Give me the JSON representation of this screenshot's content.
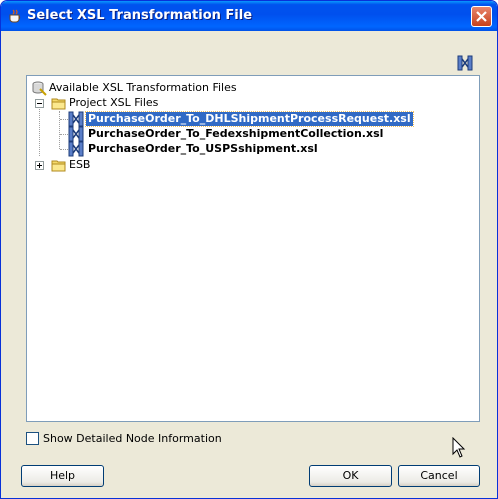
{
  "window": {
    "title": "Select XSL Transformation File"
  },
  "tree": {
    "root_label": "Available XSL Transformation Files",
    "folders": [
      {
        "label": "Project XSL Files",
        "expanded": true,
        "files": [
          {
            "label": "PurchaseOrder_To_DHLShipmentProcessRequest.xsl",
            "selected": true
          },
          {
            "label": "PurchaseOrder_To_FedexshipmentCollection.xsl",
            "selected": false
          },
          {
            "label": "PurchaseOrder_To_USPSshipment.xsl",
            "selected": false
          }
        ]
      },
      {
        "label": "ESB",
        "expanded": false,
        "files": []
      }
    ]
  },
  "options": {
    "show_detail_label": "Show Detailed Node Information",
    "show_detail_checked": false
  },
  "buttons": {
    "help": "Help",
    "ok": "OK",
    "cancel": "Cancel"
  },
  "icons": {
    "title": "java-cup-icon",
    "toolbar": "xsl-map-icon",
    "root": "database-icon",
    "folder": "folder-icon",
    "file": "xsl-map-icon",
    "close": "close-icon"
  },
  "colors": {
    "titlebar": "#0054e3",
    "selection": "#316ac5",
    "dialog_bg": "#ece9d8"
  }
}
